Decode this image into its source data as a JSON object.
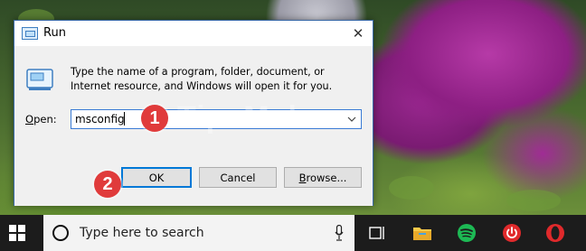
{
  "dialog": {
    "title": "Run",
    "close_glyph": "✕",
    "description": "Type the name of a program, folder, document, or Internet resource, and Windows will open it for you.",
    "open_label_accel": "O",
    "open_label_rest": "pen:",
    "input_value": "msconfig",
    "ok_label": "OK",
    "cancel_label": "Cancel",
    "browse_label_accel": "B",
    "browse_label_rest": "rowse..."
  },
  "callouts": [
    "1",
    "2"
  ],
  "watermark": {
    "text": "TipsMake",
    "suffix": ".com"
  },
  "taskbar": {
    "search_placeholder": "Type here to search",
    "icons": [
      "windows-start-icon",
      "task-view-icon",
      "file-explorer-icon",
      "spotify-icon",
      "power-app-icon",
      "opera-icon"
    ]
  }
}
